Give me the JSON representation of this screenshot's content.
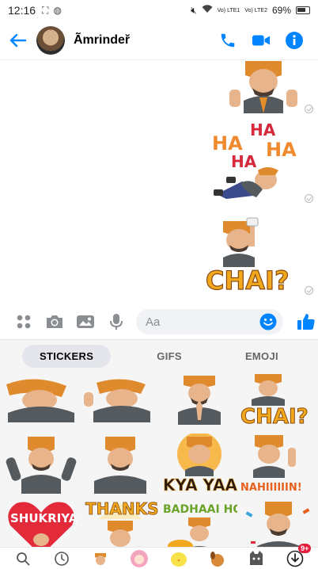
{
  "status_bar": {
    "time": "12:16",
    "net_1": "Vo) LTE1",
    "net_2": "Vo) LTE2",
    "battery": "69%"
  },
  "header": {
    "contact_name": "Ãmrindeř",
    "accent_color": "#0084ff"
  },
  "messages": [
    {
      "type": "sticker",
      "sticker": "thumbs-up-sticker"
    },
    {
      "type": "sticker",
      "sticker": "ha-ha-laughing-sticker",
      "text_lines": [
        "HA",
        "HA",
        "HA",
        "HA"
      ]
    },
    {
      "type": "sticker",
      "sticker": "chai-sticker",
      "text": "CHAI?"
    }
  ],
  "composer": {
    "placeholder": "Aa"
  },
  "tray": {
    "tabs": [
      {
        "label": "STICKERS",
        "active": true
      },
      {
        "label": "GIFS",
        "active": false
      },
      {
        "label": "EMOJI",
        "active": false
      }
    ],
    "stickers": [
      {
        "name": "sticker-lying-arms",
        "text": ""
      },
      {
        "name": "sticker-lying-hand",
        "text": ""
      },
      {
        "name": "sticker-namaste",
        "text": ""
      },
      {
        "name": "sticker-chai",
        "text": "CHAI?"
      },
      {
        "name": "sticker-arms-up",
        "text": ""
      },
      {
        "name": "sticker-clap",
        "text": ""
      },
      {
        "name": "sticker-kya-yaar",
        "text": "KYA YAAR"
      },
      {
        "name": "sticker-nahi",
        "text": "NAHIIIIIIN!"
      },
      {
        "name": "sticker-shukriya",
        "text": "SHUKRIYA"
      },
      {
        "name": "sticker-thanks",
        "text": "THANKS!"
      },
      {
        "name": "sticker-badhaai-ho",
        "text": "BADHAAI HO!"
      },
      {
        "name": "sticker-confetti",
        "text": ""
      }
    ]
  },
  "bottom_bar": {
    "badge_count": "9+"
  }
}
